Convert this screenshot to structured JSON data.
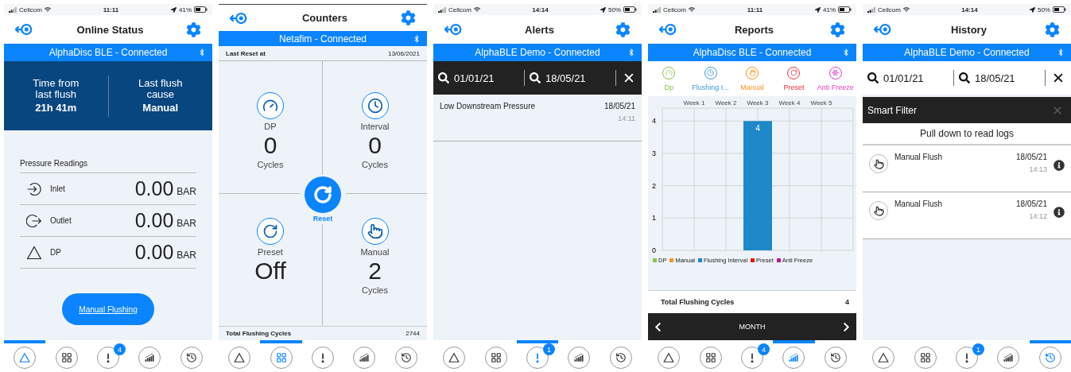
{
  "screens": [
    {
      "kind": "online_status",
      "status_bar": {
        "carrier": "Cellcom",
        "time": "11:11",
        "battery": "41%"
      },
      "title": "Online Status",
      "connection": "AlphaDisc BLE - Connected",
      "summary": [
        {
          "label": "Time from last flush",
          "value": "21h 41m"
        },
        {
          "label": "Last flush cause",
          "value": "Manual"
        }
      ],
      "readings_title": "Pressure Readings",
      "readings": [
        {
          "kind": "inlet",
          "label": "Inlet",
          "value": "0.00",
          "unit": "BAR"
        },
        {
          "kind": "outlet",
          "label": "Outlet",
          "value": "0.00",
          "unit": "BAR"
        },
        {
          "kind": "dp",
          "label": "DP",
          "value": "0.00",
          "unit": "BAR"
        }
      ],
      "button": "Manual Flushing",
      "nav": [
        {
          "kind": "dp",
          "selected": true
        },
        {
          "kind": "counters",
          "selected": false
        },
        {
          "kind": "alerts",
          "selected": false,
          "badge": "4"
        },
        {
          "kind": "reports",
          "selected": false
        },
        {
          "kind": "history",
          "selected": false
        }
      ]
    },
    {
      "kind": "counters",
      "title": "Counters",
      "connection": "Netafim - Connected",
      "last_reset": {
        "label": "Last Reset at",
        "value": "13/06/2021"
      },
      "counters": [
        {
          "kind": "dp",
          "label": "DP",
          "value": "0",
          "unit": "Cycles"
        },
        {
          "kind": "interval",
          "label": "Interval",
          "value": "0",
          "unit": "Cycles"
        },
        {
          "kind": "preset",
          "label": "Preset",
          "value": "Off"
        },
        {
          "kind": "manual",
          "label": "Manual",
          "value": "2",
          "unit": "Cycles"
        }
      ],
      "reset": "Reset",
      "total": {
        "label": "Total Flushing Cycles",
        "value": "2744"
      },
      "nav": [
        {
          "kind": "dp",
          "selected": false
        },
        {
          "kind": "counters",
          "selected": true
        },
        {
          "kind": "alerts",
          "selected": false
        },
        {
          "kind": "reports",
          "selected": false
        },
        {
          "kind": "history",
          "selected": false
        }
      ]
    },
    {
      "kind": "alerts",
      "status_bar": {
        "carrier": "Cellcom",
        "time": "14:14",
        "battery": "50%"
      },
      "title": "Alerts",
      "connection": "AlphaBLE Demo - Connected",
      "filter": {
        "from": "01/01/21",
        "to": "18/05/21"
      },
      "alerts": [
        {
          "title": "Low Downstream Pressure",
          "date": "18/05/21",
          "time": "14:11"
        }
      ],
      "nav": [
        {
          "kind": "dp",
          "selected": false
        },
        {
          "kind": "counters",
          "selected": false
        },
        {
          "kind": "alerts",
          "selected": true,
          "badge": "1"
        },
        {
          "kind": "reports",
          "selected": false
        },
        {
          "kind": "history",
          "selected": false
        }
      ]
    },
    {
      "kind": "reports",
      "status_bar": {
        "carrier": "Cellcom",
        "time": "11:11",
        "battery": "41%"
      },
      "title": "Reports",
      "connection": "AlphaDisc BLE - Connected",
      "categories": [
        {
          "kind": "dp",
          "label": "Dp",
          "color": "#8bc34a"
        },
        {
          "kind": "interval",
          "label": "Flushing I...",
          "color": "#3a9ad9"
        },
        {
          "kind": "manual",
          "label": "Manual",
          "color": "#f7941d"
        },
        {
          "kind": "preset",
          "label": "Preset",
          "color": "#f0303a"
        },
        {
          "kind": "antifreeze",
          "label": "Anti Freeze",
          "color": "#e040c0"
        }
      ],
      "chart_data": {
        "type": "bar",
        "categories": [
          "Week 1",
          "Week 2",
          "Week 3",
          "Week 4",
          "Week 5"
        ],
        "ylim": [
          0,
          4.4
        ],
        "yticks": [
          0,
          1,
          2,
          3,
          4
        ],
        "stacked": true,
        "grid": true,
        "series": [
          {
            "name": "DP",
            "color": "#8bc34a",
            "values": [
              0,
              0,
              0,
              0,
              0
            ],
            "value_labels": [
              null,
              null,
              null,
              null,
              null
            ]
          },
          {
            "name": "Manual",
            "color": "#f7941d",
            "values": [
              0,
              0,
              0,
              0,
              0
            ],
            "value_labels": [
              null,
              null,
              null,
              null,
              null
            ]
          },
          {
            "name": "Flushing Interval",
            "color": "#1e88c8",
            "values": [
              0,
              0,
              4,
              0,
              0
            ],
            "value_labels": [
              null,
              null,
              "4",
              null,
              null
            ]
          },
          {
            "name": "Preset",
            "color": "#e81010",
            "values": [
              0,
              0,
              0,
              0,
              0
            ],
            "value_labels": [
              null,
              null,
              null,
              null,
              null
            ]
          },
          {
            "name": "Anti Freeze",
            "color": "#c0169c",
            "values": [
              0,
              0,
              0,
              0,
              0
            ],
            "value_labels": [
              null,
              null,
              null,
              null,
              null
            ]
          }
        ]
      },
      "total": {
        "label": "Total Flushing Cycles",
        "value": "4"
      },
      "period": "MONTH",
      "nav": [
        {
          "kind": "dp",
          "selected": false
        },
        {
          "kind": "counters",
          "selected": false
        },
        {
          "kind": "alerts",
          "selected": false,
          "badge": "4"
        },
        {
          "kind": "reports",
          "selected": true
        },
        {
          "kind": "history",
          "selected": false
        }
      ]
    },
    {
      "kind": "history",
      "status_bar": {
        "carrier": "Cellcom",
        "time": "14:14",
        "battery": "50%"
      },
      "title": "History",
      "connection": "AlphaBLE Demo - Connected",
      "filter": {
        "from": "01/01/21",
        "to": "18/05/21"
      },
      "smart_filter": "Smart Filter",
      "hint": "Pull down to read logs",
      "logs": [
        {
          "title": "Manual Flush",
          "date": "18/05/21",
          "time": "14:13"
        },
        {
          "title": "Manual Flush",
          "date": "18/05/21",
          "time": "14:12"
        }
      ],
      "nav": [
        {
          "kind": "dp",
          "selected": false
        },
        {
          "kind": "counters",
          "selected": false
        },
        {
          "kind": "alerts",
          "selected": false,
          "badge": "1"
        },
        {
          "kind": "reports",
          "selected": false
        },
        {
          "kind": "history",
          "selected": true
        }
      ]
    }
  ]
}
